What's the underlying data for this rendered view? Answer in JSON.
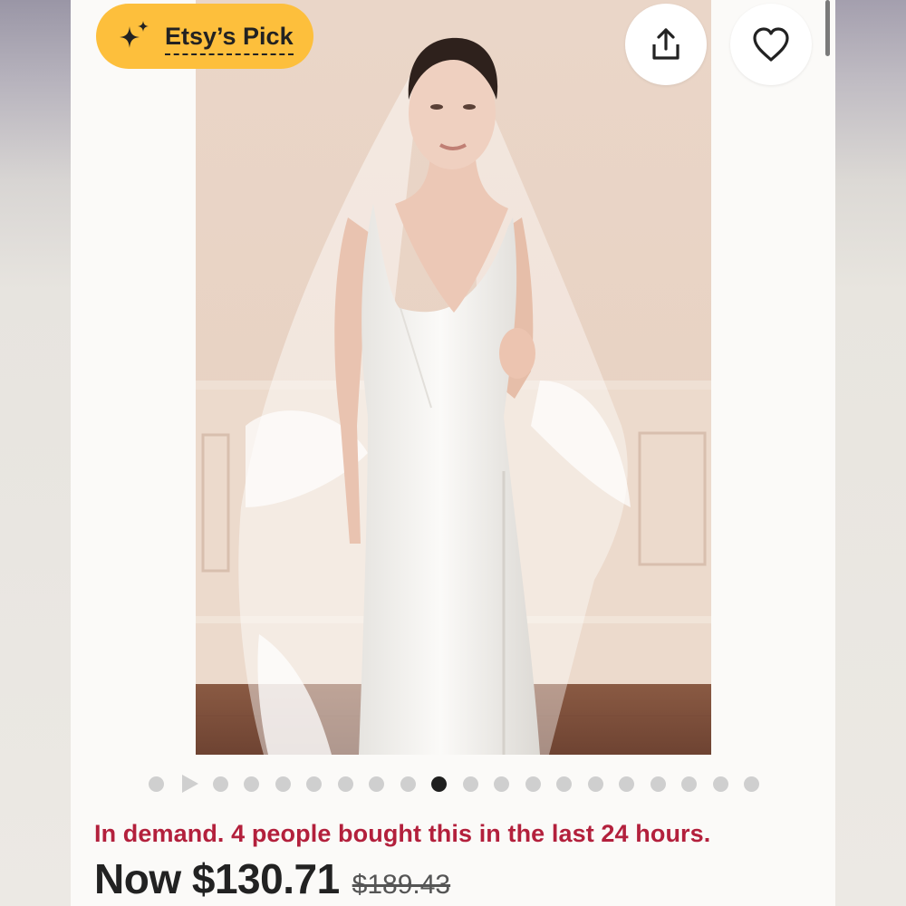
{
  "badge": {
    "label": "Etsy’s Pick",
    "icon": "sparkle-icon"
  },
  "actions": {
    "share_icon": "share-icon",
    "favorite_icon": "heart-icon"
  },
  "photo": {
    "subject": "model-wearing-lace-veil-and-white-dress"
  },
  "carousel": {
    "total": 20,
    "active_index": 9,
    "video_index": 1
  },
  "demand_text": "In demand. 4 people bought this in the last 24 hours.",
  "price": {
    "now": "Now $130.71",
    "original": "$189.43"
  },
  "colors": {
    "accent": "#fdbf3c",
    "demand": "#b3203c",
    "text": "#222222"
  }
}
